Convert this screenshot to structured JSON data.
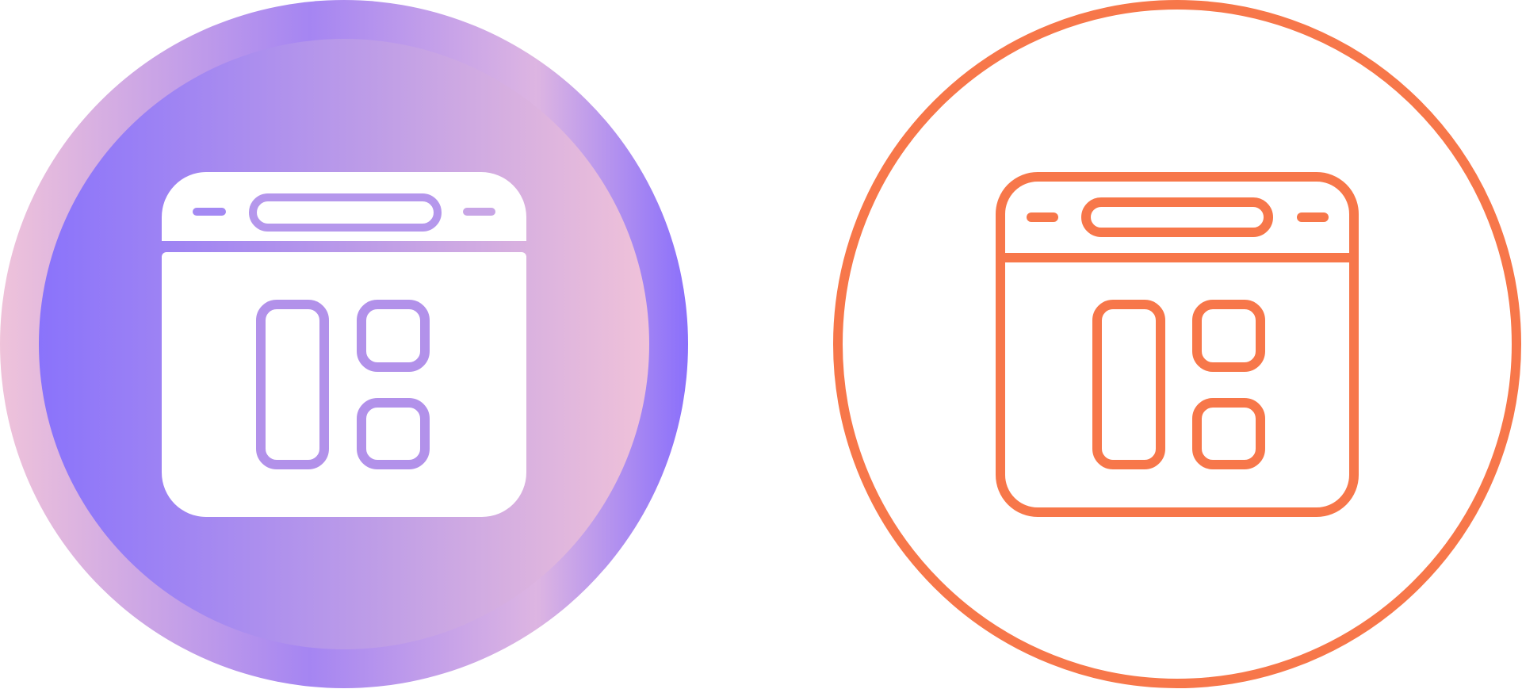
{
  "icons": [
    {
      "name": "browser-dashboard-icon",
      "style": "glyph",
      "circle_gradient": [
        "#efc3da",
        "#8a73fb",
        "#e0b7e0",
        "#8a6ffb"
      ],
      "inner_gradient": [
        "#8a73fb",
        "#b99ae8",
        "#efc3da"
      ],
      "glyph_color": "#ffffff",
      "accent_color": "#b28fe9"
    },
    {
      "name": "browser-dashboard-icon",
      "style": "outline",
      "stroke_color": "#f7774a",
      "background": "#ffffff"
    }
  ]
}
